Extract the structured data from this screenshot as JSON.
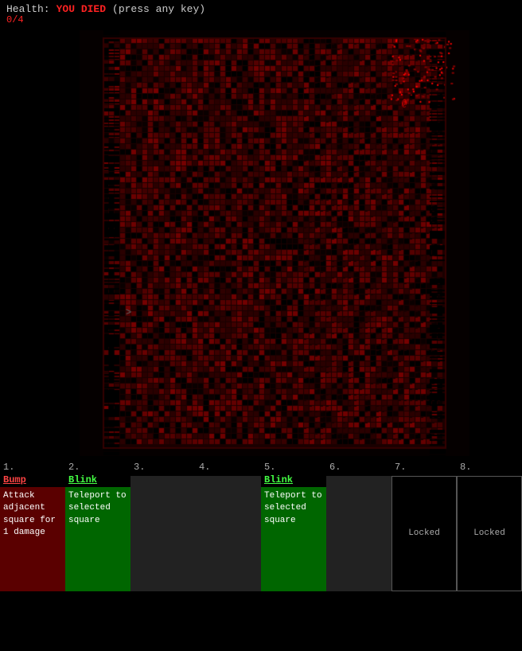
{
  "header": {
    "health_label": "Health:",
    "health_value": "0/4",
    "died_text": "YOU DIED",
    "press_key_text": "(press any key)"
  },
  "abilities": [
    {
      "number": "1.",
      "name": "Bump",
      "name_color": "red",
      "slot_type": "red",
      "description": "Attack adjacent square for 1 damage"
    },
    {
      "number": "2.",
      "name": "Blink",
      "name_color": "green",
      "slot_type": "green",
      "description": "Teleport to selected square"
    },
    {
      "number": "3.",
      "name": "",
      "name_color": "dark",
      "slot_type": "dark",
      "description": ""
    },
    {
      "number": "4.",
      "name": "",
      "name_color": "dark",
      "slot_type": "dark",
      "description": ""
    },
    {
      "number": "5.",
      "name": "Blink",
      "name_color": "green",
      "slot_type": "green",
      "description": "Teleport to selected square"
    },
    {
      "number": "6.",
      "name": "",
      "name_color": "dark",
      "slot_type": "dark",
      "description": ""
    },
    {
      "number": "7.",
      "name": "",
      "name_color": "locked",
      "slot_type": "locked",
      "description": "Locked"
    },
    {
      "number": "8.",
      "name": "",
      "name_color": "locked",
      "slot_type": "locked",
      "description": "Locked"
    }
  ],
  "arrow": ">"
}
